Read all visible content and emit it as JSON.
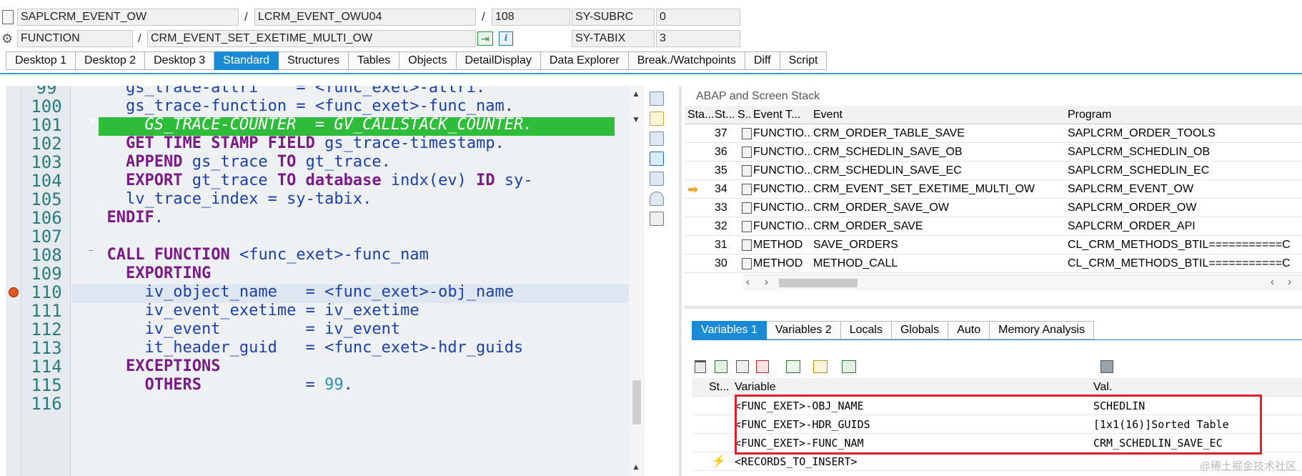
{
  "header": {
    "program": "SAPLCRM_EVENT_OW",
    "include": "LCRM_EVENT_OWU04",
    "line": "108",
    "type": "FUNCTION",
    "name": "CRM_EVENT_SET_EXETIME_MULTI_OW",
    "sy_subrc_label": "SY-SUBRC",
    "sy_subrc_value": "0",
    "sy_tabix_label": "SY-TABIX",
    "sy_tabix_value": "3",
    "slash": "/"
  },
  "tabs": [
    "Desktop 1",
    "Desktop 2",
    "Desktop 3",
    "Standard",
    "Structures",
    "Tables",
    "Objects",
    "DetailDisplay",
    "Data Explorer",
    "Break./Watchpoints",
    "Diff",
    "Script"
  ],
  "active_tab": "Standard",
  "code": {
    "lines": [
      {
        "n": "99",
        "text": "    gs_trace-attri    = <func_exet>-attri."
      },
      {
        "n": "100",
        "text": "    gs_trace-function = <func_exet>-func_nam."
      },
      {
        "n": "101",
        "text": "*     GS_TRACE-COUNTER  = GV_CALLSTACK_COUNTER."
      },
      {
        "n": "102",
        "text": "    GET TIME STAMP FIELD gs_trace-timestamp."
      },
      {
        "n": "103",
        "text": "    APPEND gs_trace TO gt_trace."
      },
      {
        "n": "104",
        "text": "    EXPORT gt_trace TO database indx(ev) ID sy-"
      },
      {
        "n": "105",
        "text": "    lv_trace_index = sy-tabix."
      },
      {
        "n": "106",
        "text": "  ENDIF."
      },
      {
        "n": "107",
        "text": ""
      },
      {
        "n": "108",
        "text": "  CALL FUNCTION <func_exet>-func_nam"
      },
      {
        "n": "109",
        "text": "    EXPORTING"
      },
      {
        "n": "110",
        "text": "      iv_object_name   = <func_exet>-obj_name"
      },
      {
        "n": "111",
        "text": "      iv_event_exetime = iv_exetime"
      },
      {
        "n": "112",
        "text": "      iv_event         = iv_event"
      },
      {
        "n": "113",
        "text": "      it_header_guid   = <func_exet>-hdr_guids"
      },
      {
        "n": "114",
        "text": "    EXCEPTIONS"
      },
      {
        "n": "115",
        "text": "      OTHERS           = 99."
      },
      {
        "n": "116",
        "text": ""
      }
    ]
  },
  "stack": {
    "title": "ABAP and Screen Stack",
    "columns": [
      "Sta...",
      "St...",
      "S...",
      "Event T...",
      "Event",
      "Program"
    ],
    "rows": [
      {
        "level": "37",
        "type": "FUNCTIO...",
        "event": "CRM_ORDER_TABLE_SAVE",
        "program": "SAPLCRM_ORDER_TOOLS"
      },
      {
        "level": "36",
        "type": "FUNCTIO...",
        "event": "CRM_SCHEDLIN_SAVE_OB",
        "program": "SAPLCRM_SCHEDLIN_OB"
      },
      {
        "level": "35",
        "type": "FUNCTIO...",
        "event": "CRM_SCHEDLIN_SAVE_EC",
        "program": "SAPLCRM_SCHEDLIN_EC"
      },
      {
        "level": "34",
        "type": "FUNCTIO...",
        "event": "CRM_EVENT_SET_EXETIME_MULTI_OW",
        "program": "SAPLCRM_EVENT_OW"
      },
      {
        "level": "33",
        "type": "FUNCTIO...",
        "event": "CRM_ORDER_SAVE_OW",
        "program": "SAPLCRM_ORDER_OW"
      },
      {
        "level": "32",
        "type": "FUNCTIO...",
        "event": "CRM_ORDER_SAVE",
        "program": "SAPLCRM_ORDER_API"
      },
      {
        "level": "31",
        "type": "METHOD",
        "event": "SAVE_ORDERS",
        "program": "CL_CRM_METHODS_BTIL===========C"
      },
      {
        "level": "30",
        "type": "METHOD",
        "event": "METHOD_CALL",
        "program": "CL_CRM_METHODS_BTIL===========C"
      }
    ],
    "current_row": "34"
  },
  "var_tabs": [
    "Variables 1",
    "Variables 2",
    "Locals",
    "Globals",
    "Auto",
    "Memory Analysis"
  ],
  "active_var_tab": "Variables 1",
  "variables": {
    "columns": [
      "St...",
      "Variable",
      "Val."
    ],
    "rows": [
      {
        "name": "<FUNC_EXET>-OBJ_NAME",
        "value": "SCHEDLIN"
      },
      {
        "name": "<FUNC_EXET>-HDR_GUIDS",
        "value": "[1x1(16)]Sorted Table"
      },
      {
        "name": "<FUNC_EXET>-FUNC_NAM",
        "value": "CRM_SCHEDLIN_SAVE_EC"
      },
      {
        "name": "<RECORDS_TO_INSERT>",
        "value": ""
      }
    ]
  },
  "watermark": "@稀土掘金技术社区",
  "colors": {
    "accent": "#1a8ad4",
    "comment_bg": "#2ebc3a",
    "highlight_box": "#d9232d"
  }
}
